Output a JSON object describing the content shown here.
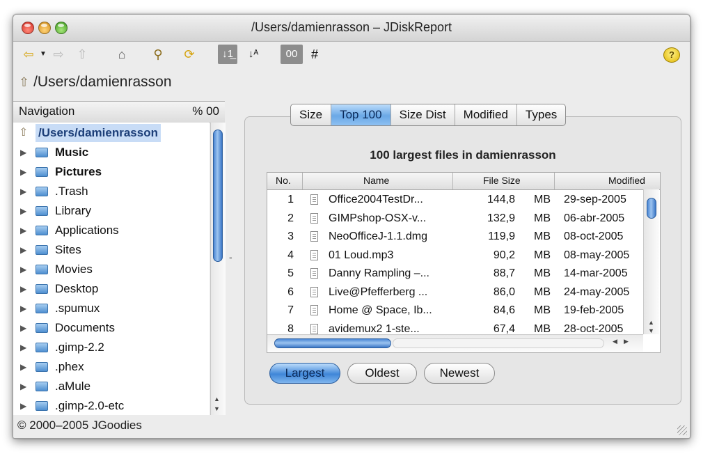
{
  "window": {
    "title": "/Users/damienrasson – JDiskReport"
  },
  "toolbar": {
    "sort_desc_glyph": "↓1̲",
    "sort_alpha_glyph": "↓ᴬ",
    "oo_label": "00",
    "hash_label": "#",
    "help_label": "?"
  },
  "path": {
    "current": "/Users/damienrasson"
  },
  "navigation": {
    "title": "Navigation",
    "pct_label": "% 00",
    "root": "/Users/damienrasson",
    "items": [
      {
        "label": "Music",
        "bold": true
      },
      {
        "label": "Pictures",
        "bold": true
      },
      {
        "label": ".Trash",
        "bold": false
      },
      {
        "label": "Library",
        "bold": false
      },
      {
        "label": "Applications",
        "bold": false
      },
      {
        "label": "Sites",
        "bold": false
      },
      {
        "label": "Movies",
        "bold": false
      },
      {
        "label": "Desktop",
        "bold": false
      },
      {
        "label": ".spumux",
        "bold": false
      },
      {
        "label": "Documents",
        "bold": false
      },
      {
        "label": ".gimp-2.2",
        "bold": false
      },
      {
        "label": ".phex",
        "bold": false
      },
      {
        "label": ".aMule",
        "bold": false
      },
      {
        "label": ".gimp-2.0-etc",
        "bold": false
      }
    ]
  },
  "tabs": [
    "Size",
    "Top 100",
    "Size Dist",
    "Modified",
    "Types"
  ],
  "active_tab": "Top 100",
  "content": {
    "title": "100 largest files in damienrasson",
    "columns": [
      "No.",
      "Name",
      "File Size",
      "Modified"
    ],
    "rows": [
      {
        "no": "1",
        "name": "Office2004TestDr...",
        "size": "144,8",
        "unit": "MB",
        "modified": "29-sep-2005"
      },
      {
        "no": "2",
        "name": "GIMPshop-OSX-v...",
        "size": "132,9",
        "unit": "MB",
        "modified": "06-abr-2005"
      },
      {
        "no": "3",
        "name": "NeoOfficeJ-1.1.dmg",
        "size": "119,9",
        "unit": "MB",
        "modified": "08-oct-2005"
      },
      {
        "no": "4",
        "name": "01 Loud.mp3",
        "size": "90,2",
        "unit": "MB",
        "modified": "08-may-2005"
      },
      {
        "no": "5",
        "name": "Danny Rampling –...",
        "size": "88,7",
        "unit": "MB",
        "modified": "14-mar-2005"
      },
      {
        "no": "6",
        "name": "Live@Pfefferberg ...",
        "size": "86,0",
        "unit": "MB",
        "modified": "24-may-2005"
      },
      {
        "no": "7",
        "name": "Home @ Space, Ib...",
        "size": "84,6",
        "unit": "MB",
        "modified": "19-feb-2005"
      },
      {
        "no": "8",
        "name": "avidemux2 1-ste...",
        "size": "67,4",
        "unit": "MB",
        "modified": "28-oct-2005"
      }
    ],
    "buttons": [
      "Largest",
      "Oldest",
      "Newest"
    ],
    "active_button": "Largest"
  },
  "footer": {
    "copyright": "© 2000–2005 JGoodies"
  }
}
